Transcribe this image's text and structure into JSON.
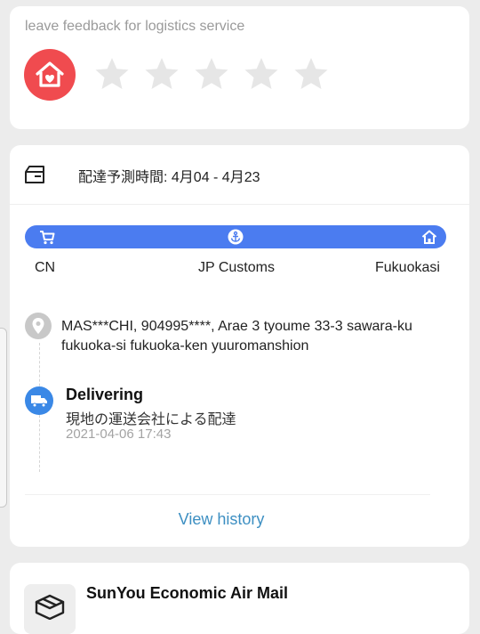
{
  "feedback": {
    "title": "leave feedback for logistics service",
    "logo_icon": "home-heart-icon",
    "rating": 0,
    "max_rating": 5,
    "star_icon": "star-icon",
    "brand_color": "#f04b4f"
  },
  "tracking": {
    "eta_icon": "package-box-icon",
    "eta_text": "配達予測時間: 4月04 - 4月23",
    "route": {
      "bar_color": "#4b7cf0",
      "stops": [
        {
          "label": "CN",
          "icon": "cart-icon"
        },
        {
          "label": "JP Customs",
          "icon": "anchor-icon"
        },
        {
          "label": "Fukuokasi",
          "icon": "home-icon"
        }
      ]
    },
    "address_icon": "location-pin-icon",
    "address": "MAS***CHI,  904995****,  Arae 3 tyoume 33-3 sawara-ku fukuoka-si fukuoka-ken yuuromanshion",
    "latest_event": {
      "icon": "truck-icon",
      "status": "Delivering",
      "description": "現地の運送会社による配達",
      "timestamp": "2021-04-06 17:43"
    },
    "view_history_label": "View history",
    "link_color": "#3d8fc2"
  },
  "carrier": {
    "icon": "parcel-icon",
    "name": "SunYou Economic Air Mail"
  }
}
